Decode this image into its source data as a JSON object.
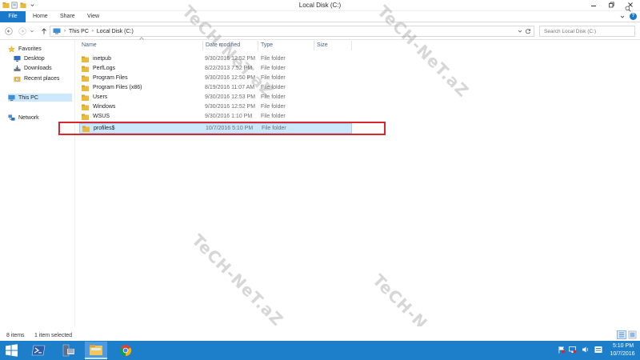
{
  "window": {
    "title": "Local Disk (C:)"
  },
  "ribbon": {
    "tabs": [
      {
        "label": "File"
      },
      {
        "label": "Home"
      },
      {
        "label": "Share"
      },
      {
        "label": "View"
      }
    ],
    "file_tab_color": "#1979ca"
  },
  "address_bar": {
    "crumbs": [
      "This PC",
      "Local Disk (C:)"
    ],
    "separator": "›"
  },
  "search": {
    "placeholder": "Search Local Disk (C:)"
  },
  "nav_pane": {
    "groups": [
      {
        "label": "Favorites",
        "icon": "star-icon",
        "items": [
          {
            "label": "Desktop",
            "icon": "desktop-icon"
          },
          {
            "label": "Downloads",
            "icon": "downloads-icon"
          },
          {
            "label": "Recent places",
            "icon": "recent-places-icon"
          }
        ]
      },
      {
        "label": "This PC",
        "icon": "computer-icon",
        "selected": true,
        "items": []
      },
      {
        "label": "Network",
        "icon": "network-icon",
        "items": []
      }
    ]
  },
  "columns": {
    "name": "Name",
    "date": "Date modified",
    "type": "Type",
    "size": "Size"
  },
  "files": [
    {
      "name": "inetpub",
      "date": "9/30/2016 12:52 PM",
      "type": "File folder",
      "size": "",
      "selected": false
    },
    {
      "name": "PerfLogs",
      "date": "8/22/2013 7:52 PM",
      "type": "File folder",
      "size": "",
      "selected": false
    },
    {
      "name": "Program Files",
      "date": "9/30/2016 12:50 PM",
      "type": "File folder",
      "size": "",
      "selected": false
    },
    {
      "name": "Program Files (x86)",
      "date": "8/19/2016 11:07 AM",
      "type": "File folder",
      "size": "",
      "selected": false
    },
    {
      "name": "Users",
      "date": "9/30/2016 12:53 PM",
      "type": "File folder",
      "size": "",
      "selected": false
    },
    {
      "name": "Windows",
      "date": "9/30/2016 12:52 PM",
      "type": "File folder",
      "size": "",
      "selected": false
    },
    {
      "name": "WSUS",
      "date": "9/30/2016 1:10 PM",
      "type": "File folder",
      "size": "",
      "selected": false
    },
    {
      "name": "profiles$",
      "date": "10/7/2016 5:10 PM",
      "type": "File folder",
      "size": "",
      "selected": true
    }
  ],
  "status_bar": {
    "item_count": "8 items",
    "selection": "1 item selected"
  },
  "taskbar": {
    "apps": [
      {
        "name": "powershell-icon"
      },
      {
        "name": "server-manager-icon"
      },
      {
        "name": "file-explorer-icon",
        "active": true
      },
      {
        "name": "chrome-icon"
      }
    ],
    "clock_time": "5:10 PM",
    "clock_date": "10/7/2016",
    "color": "#1d7ec9"
  },
  "annotation": {
    "highlight_color": "#d9262f"
  },
  "watermark": {
    "text": "TeCH-NeT.aZ"
  },
  "colors": {
    "selection_fill": "#cce8ff",
    "folder": "#e8b93a"
  }
}
